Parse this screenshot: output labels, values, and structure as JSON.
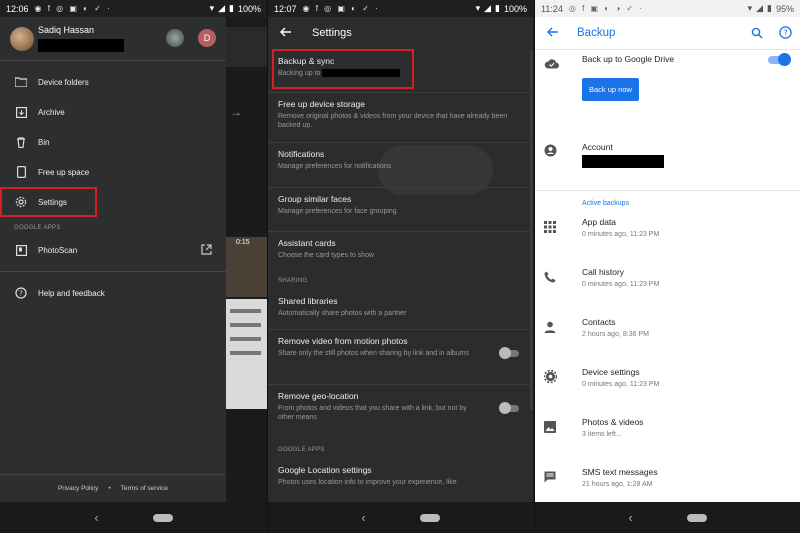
{
  "panel1": {
    "status": {
      "time": "12:06",
      "battery": "100%"
    },
    "user": {
      "name": "Sadiq Hassan",
      "secondary_avatar_letter": "D"
    },
    "menu": [
      {
        "label": "Device folders",
        "icon": "folder-icon"
      },
      {
        "label": "Archive",
        "icon": "archive-icon"
      },
      {
        "label": "Bin",
        "icon": "bin-icon"
      },
      {
        "label": "Free up space",
        "icon": "phone-icon"
      },
      {
        "label": "Settings",
        "icon": "gear-icon"
      }
    ],
    "google_apps_header": "GOOGLE APPS",
    "photoscan_label": "PhotoScan",
    "help_label": "Help and feedback",
    "footer": {
      "privacy": "Privacy Policy",
      "separator": "•",
      "terms": "Terms of service"
    },
    "background": {
      "video_duration": "0:15"
    }
  },
  "panel2": {
    "status": {
      "time": "12:07",
      "battery": "100%"
    },
    "title": "Settings",
    "backup": {
      "title": "Backup & sync",
      "desc": "Backing up to"
    },
    "items": [
      {
        "title": "Free up device storage",
        "desc": "Remove original photos & videos from your device that have already been backed up."
      },
      {
        "title": "Notifications",
        "desc": "Manage preferences for notifications"
      },
      {
        "title": "Group similar faces",
        "desc": "Manage preferences for face grouping"
      },
      {
        "title": "Assistant cards",
        "desc": "Choose the card types to show"
      }
    ],
    "sharing_header": "SHARING",
    "sharing_items": [
      {
        "title": "Shared libraries",
        "desc": "Automatically share photos with a partner"
      },
      {
        "title": "Remove video from motion photos",
        "desc": "Share only the still photos when sharing by link and in albums"
      },
      {
        "title": "Remove geo-location",
        "desc": "From photos and videos that you share with a link, but not by other means"
      }
    ],
    "google_apps_header": "GOOGLE APPS",
    "location": {
      "title": "Google Location settings",
      "desc": "Photos uses location info to improve your experience, like"
    }
  },
  "panel3": {
    "status": {
      "time": "11:24",
      "battery": "95%"
    },
    "title": "Backup",
    "drive": {
      "label": "Back up to Google Drive",
      "button": "Back up now"
    },
    "account_label": "Account",
    "active_header": "Active backups",
    "backups": [
      {
        "title": "App data",
        "desc": "0 minutes ago, 11:23 PM",
        "icon": "grid-icon"
      },
      {
        "title": "Call history",
        "desc": "0 minutes ago, 11:23 PM",
        "icon": "phone-call-icon"
      },
      {
        "title": "Contacts",
        "desc": "2 hours ago, 8:36 PM",
        "icon": "person-icon"
      },
      {
        "title": "Device settings",
        "desc": "0 minutes ago, 11:23 PM",
        "icon": "gear-icon"
      },
      {
        "title": "Photos & videos",
        "desc": "3 items left...",
        "icon": "image-icon"
      },
      {
        "title": "SMS text messages",
        "desc": "21 hours ago, 1:28 AM",
        "icon": "message-icon"
      }
    ]
  }
}
